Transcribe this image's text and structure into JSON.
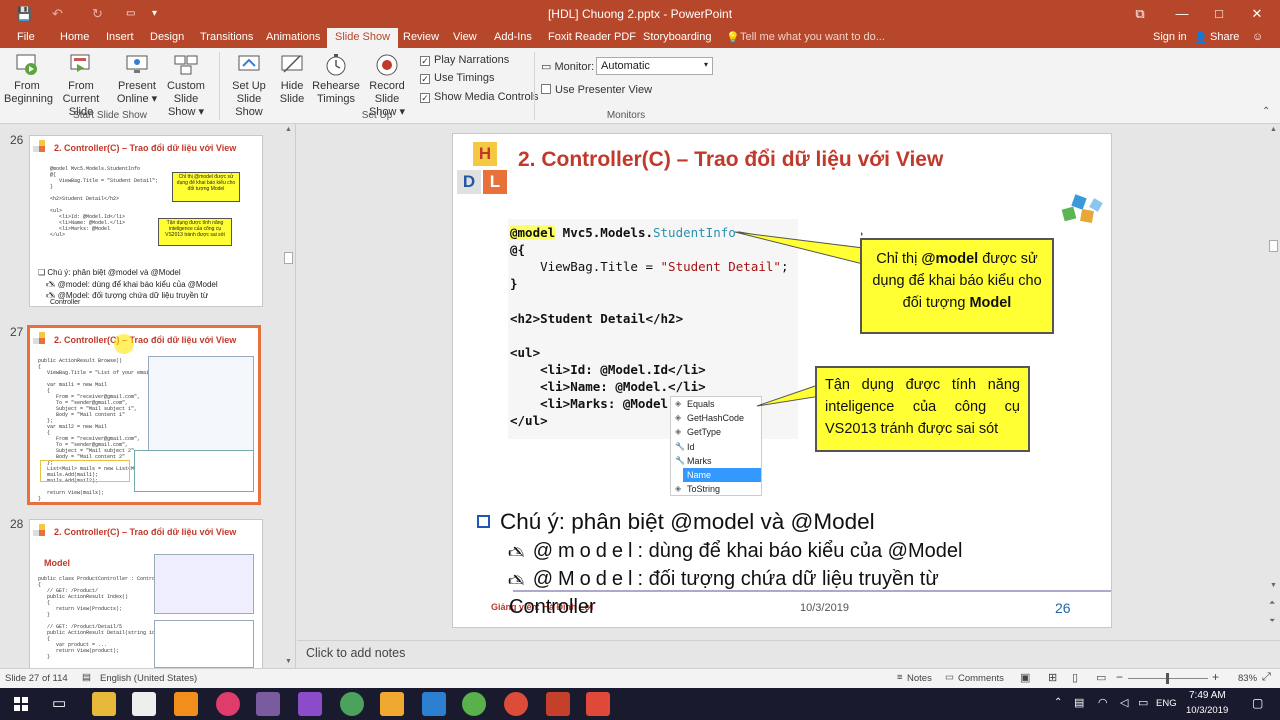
{
  "window": {
    "title": "[HDL] Chuong 2.pptx - PowerPoint",
    "controls": {
      "restore": "⧉",
      "minimize": "—",
      "maximize": "□",
      "close": "✕"
    }
  },
  "quick_access": {
    "save_icon": "💾",
    "undo_icon": "↶",
    "redo_icon": "↻",
    "customize_icon": "▾"
  },
  "tabs": [
    "File",
    "Home",
    "Insert",
    "Design",
    "Transitions",
    "Animations",
    "Slide Show",
    "Review",
    "View",
    "Add-Ins",
    "Foxit Reader PDF",
    "Storyboarding"
  ],
  "active_tab": "Slide Show",
  "tell_me": "Tell me what you want to do...",
  "sign_in": "Sign in",
  "share": "Share",
  "ribbon": {
    "start_group": {
      "label": "Start Slide Show",
      "from_beginning": [
        "From",
        "Beginning"
      ],
      "from_current": [
        "From",
        "Current Slide"
      ],
      "present_online": [
        "Present",
        "Online ▾"
      ],
      "custom_show": [
        "Custom Slide",
        "Show ▾"
      ]
    },
    "setup_group": {
      "label": "Set Up",
      "setup_show": [
        "Set Up",
        "Slide Show"
      ],
      "hide_slide": [
        "Hide",
        "Slide"
      ],
      "rehearse": [
        "Rehearse",
        "Timings"
      ],
      "record": [
        "Record Slide",
        "Show ▾"
      ],
      "play_narrations": "Play Narrations",
      "use_timings": "Use Timings",
      "show_media_controls": "Show Media Controls"
    },
    "monitors_group": {
      "label": "Monitors",
      "monitor_label": "Monitor:",
      "monitor_value": "Automatic",
      "use_presenter_view": "Use Presenter View"
    }
  },
  "thumbnails": [
    {
      "number": "26",
      "title": "2. Controller(C) – Trao đổi dữ liệu với View",
      "note": "❑ Chú ý: phân biệt @model và @Model",
      "sub1": "🖎 @model: dùng để khai báo kiểu của @Model",
      "sub2": "🖎 @Model: đối tượng chứa dữ liệu truyền từ",
      "sub3": "Controller",
      "callout1": "Chỉ thị @model được sử dụng để khai báo kiểu cho đối tượng Model",
      "callout2": "Tận dụng được tính năng inteligence của công cụ VS2013 tránh được sai sót"
    },
    {
      "number": "27",
      "title": "2. Controller(C) – Trao đổi dữ liệu với View"
    },
    {
      "number": "28",
      "title": "2. Controller(C) – Trao đổi dữ liệu với View",
      "heading": "Model"
    }
  ],
  "slide": {
    "h_letter": "H",
    "d_letter": "D",
    "l_letter": "L",
    "title": "2. Controller(C) – Trao đổi dữ liệu với View",
    "code": {
      "line1_kw": "@model",
      "line1_rest": " Mvc5.Models.",
      "line1_cls": "StudentInfo",
      "line2": "@{",
      "line3_a": "    ViewBag.Title = ",
      "line3_str": "\"Student Detail\"",
      "line3_b": ";",
      "line4": "}",
      "line5": "<h2>Student Detail</h2>",
      "line6": "<ul>",
      "line7": "    <li>Id: @Model.Id</li>",
      "line8": "    <li>Name: @Model.</li>",
      "line9": "    <li>Marks: @Model",
      "line10": "</ul>"
    },
    "intellisense": [
      "Equals",
      "GetHashCode",
      "GetType",
      "Id",
      "Marks",
      "Name",
      "ToString"
    ],
    "intellisense_selected": "Name",
    "callout1_a": "Chỉ thị ",
    "callout1_b": "@model",
    "callout1_c": " được sử dụng để khai báo kiểu cho đối tượng ",
    "callout1_d": "Model",
    "callout2": "Tận dụng được tính năng inteligence của công cụ VS2013 tránh được sai sót",
    "note": "Chú ý: phân biệt @model và @Model",
    "sub1_kw": "@model",
    "sub1_text": ": dùng để khai báo kiểu của @Model",
    "sub2_kw": "@Model",
    "sub2_text": ":  đối tượng chứa dữ liệu truyền từ",
    "sub3": "Controller",
    "bullet_glyph": "🖎",
    "footer_left": "Giảng viên: Hà Đình Lợi",
    "footer_date": "10/3/2019",
    "footer_page": "26"
  },
  "notes_placeholder": "Click to add notes",
  "status": {
    "slide_info": "Slide 27 of 114",
    "language": "English (United States)",
    "notes": "Notes",
    "comments": "Comments",
    "zoom": "83%"
  },
  "taskbar": {
    "lang": "ENG",
    "time": "7:49 AM",
    "date": "10/3/2019"
  },
  "colors": {
    "accent": "#b7472a",
    "title_red": "#c0392b",
    "callout_yellow": "#ffff33",
    "selection_orange": "#e8703a"
  }
}
